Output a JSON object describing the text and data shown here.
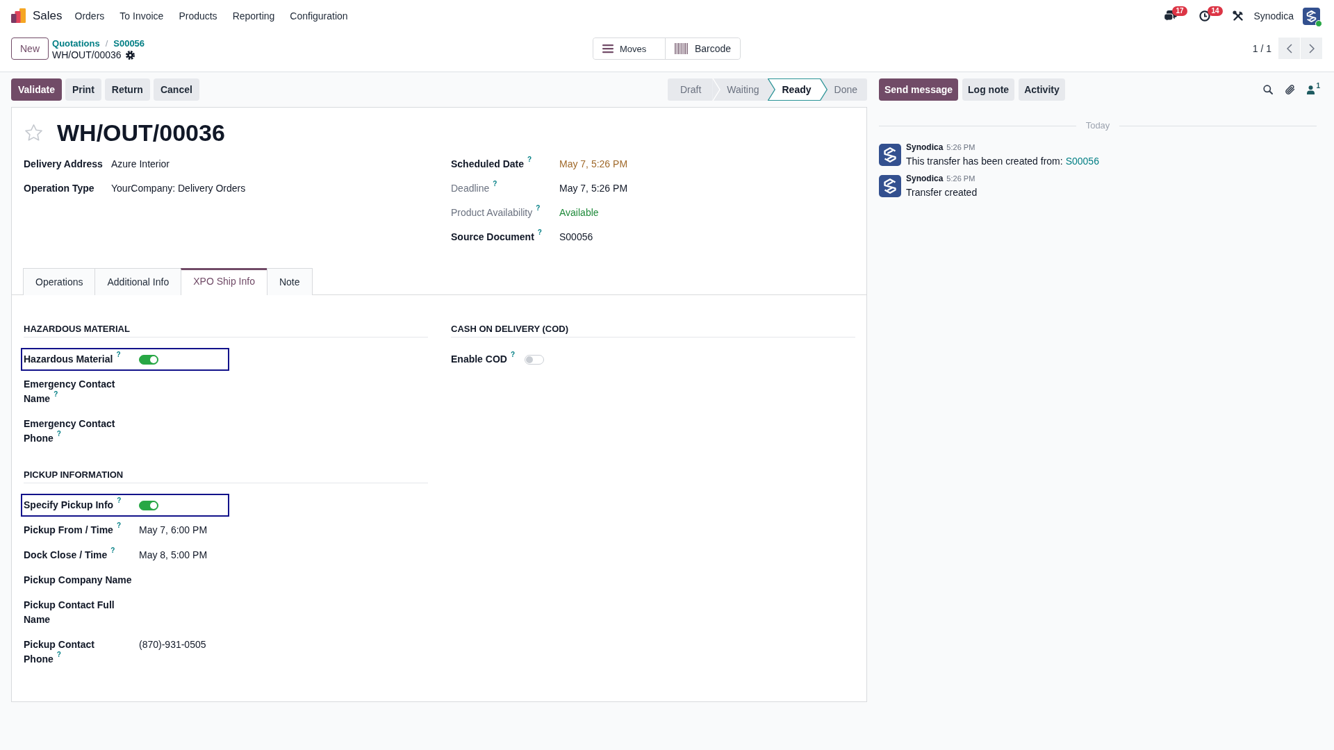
{
  "navbar": {
    "app_name": "Sales",
    "menu": [
      {
        "label": "Orders"
      },
      {
        "label": "To Invoice"
      },
      {
        "label": "Products"
      },
      {
        "label": "Reporting"
      },
      {
        "label": "Configuration"
      }
    ],
    "messages_count": "17",
    "activities_count": "14",
    "user": "Synodica"
  },
  "control_panel": {
    "new_button": "New",
    "breadcrumbs": [
      {
        "label": "Quotations"
      },
      {
        "label": "S00056"
      }
    ],
    "separator": "/",
    "record": "WH/OUT/00036",
    "views": [
      {
        "kind": "list",
        "label": "Moves"
      },
      {
        "kind": "barcode",
        "label": "Barcode"
      }
    ],
    "pager": "1 / 1"
  },
  "actions": [
    {
      "label": "Validate",
      "primary": true
    },
    {
      "label": "Print",
      "primary": false
    },
    {
      "label": "Return",
      "primary": false
    },
    {
      "label": "Cancel",
      "primary": false
    }
  ],
  "status_bar": [
    {
      "label": "Draft",
      "selected": false
    },
    {
      "label": "Waiting",
      "selected": false
    },
    {
      "label": "Ready",
      "selected": true
    },
    {
      "label": "Done",
      "selected": false
    }
  ],
  "form": {
    "starred": false,
    "title": "WH/OUT/00036",
    "left_fields": [
      {
        "label": "Delivery Address",
        "value": "Azure Interior",
        "muted": false
      },
      {
        "label": "Operation Type",
        "value": "YourCompany: Delivery Orders",
        "muted": false
      }
    ],
    "right_fields": [
      {
        "label": "Scheduled Date",
        "help": "?",
        "value": "May 7, 5:26 PM",
        "muted": false,
        "color": "#a0692a"
      },
      {
        "label": "Deadline",
        "help": "?",
        "value": "May 7, 5:26 PM",
        "muted": true
      },
      {
        "label": "Product Availability",
        "help": "?",
        "value": "Available",
        "muted": true,
        "color": "#1f8a3a"
      },
      {
        "label": "Source Document",
        "help": "?",
        "value": "S00056",
        "muted": false
      }
    ],
    "tabs": [
      {
        "label": "Operations",
        "selected": false
      },
      {
        "label": "Additional Info",
        "selected": false
      },
      {
        "label": "XPO Ship Info",
        "selected": true
      },
      {
        "label": "Note",
        "selected": false
      }
    ],
    "tab_content": {
      "left_column": [
        {
          "title": "HAZARDOUS MATERIAL",
          "fields": [
            {
              "kind": "toggle",
              "label": "Hazardous Material",
              "help": "?",
              "on": true,
              "outlined": true
            },
            {
              "kind": "text",
              "label": "Emergency Contact Name",
              "help": "?",
              "outlined": false
            },
            {
              "kind": "text",
              "label": "Emergency Contact Phone",
              "help": "?",
              "outlined": false
            }
          ]
        },
        {
          "title": "PICKUP INFORMATION",
          "fields": [
            {
              "kind": "toggle",
              "label": "Specify Pickup Info",
              "help": "?",
              "on": true,
              "outlined": true
            },
            {
              "kind": "text",
              "label": "Pickup From / Time",
              "help": "?",
              "value": "May 7, 6:00 PM",
              "outlined": false
            },
            {
              "kind": "text",
              "label": "Dock Close / Time",
              "help": "?",
              "value": "May 8, 5:00 PM",
              "outlined": false
            },
            {
              "kind": "text",
              "label": "Pickup Company Name",
              "outlined": false
            },
            {
              "kind": "text",
              "label": "Pickup Contact Full Name",
              "outlined": false
            },
            {
              "kind": "text",
              "label": "Pickup Contact Phone",
              "help": "?",
              "value": "(870)-931-0505",
              "outlined": false
            }
          ]
        }
      ],
      "right_column": [
        {
          "title": "CASH ON DELIVERY (COD)",
          "fields": [
            {
              "kind": "toggle",
              "label": "Enable COD",
              "help": "?",
              "on": false,
              "outlined": false
            }
          ]
        }
      ]
    }
  },
  "chatter": {
    "buttons": [
      {
        "label": "Send message",
        "primary": true
      },
      {
        "label": "Log note",
        "primary": false
      },
      {
        "label": "Activity",
        "primary": false
      }
    ],
    "followers": "1",
    "divider": "Today",
    "messages": [
      {
        "author": "Synodica",
        "time": "5:26 PM",
        "body": "This transfer has been created from:",
        "link": "S00056"
      },
      {
        "author": "Synodica",
        "time": "5:26 PM",
        "body": "Transfer created"
      }
    ]
  }
}
